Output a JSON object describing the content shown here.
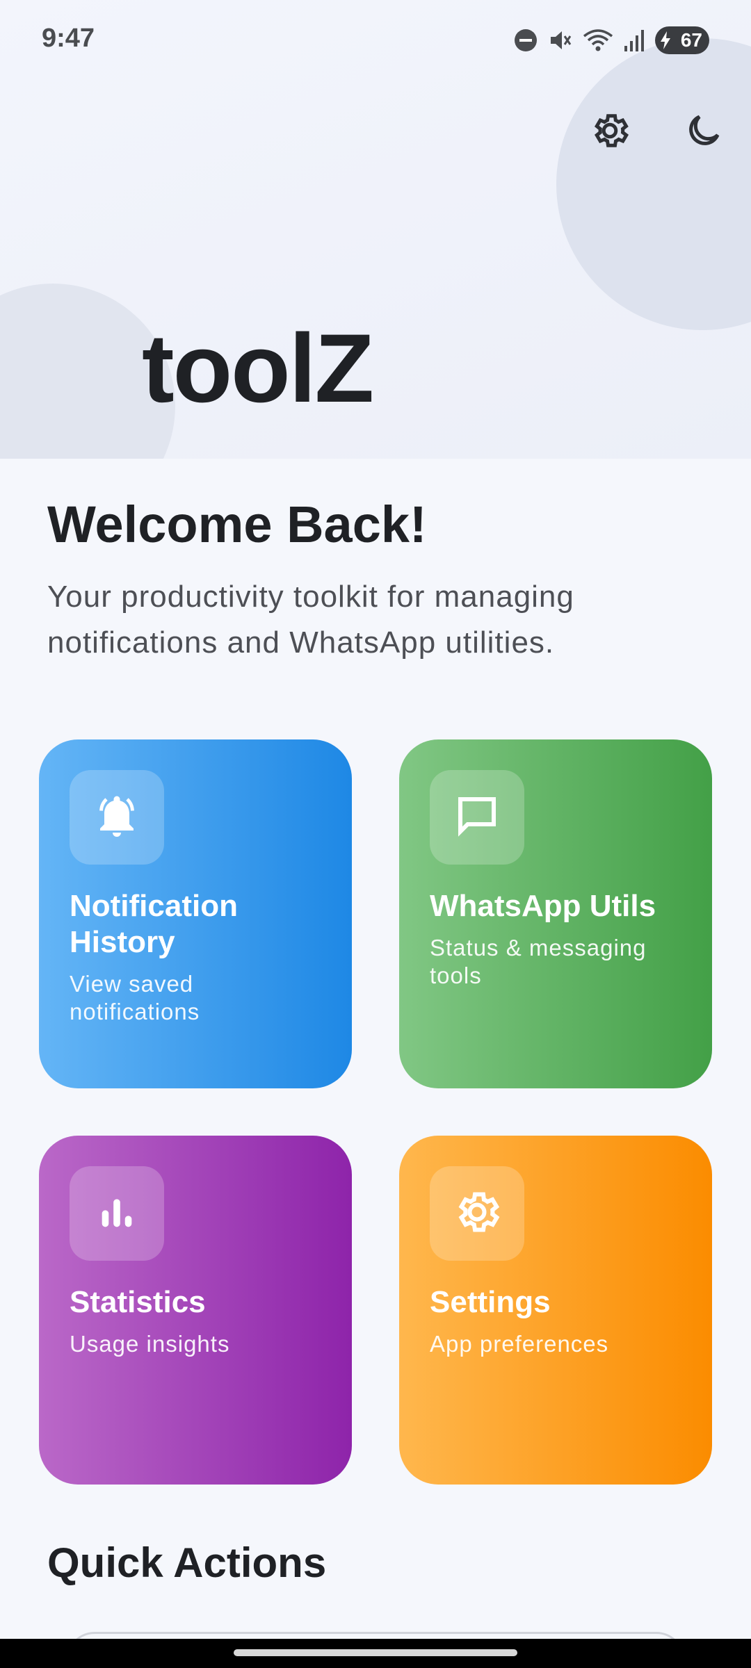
{
  "status_bar": {
    "time": "9:47",
    "battery_level": "67",
    "icons": [
      "do-not-disturb-icon",
      "mute-icon",
      "wifi-icon",
      "signal-icon",
      "battery-charging-icon"
    ]
  },
  "header": {
    "app_title": "toolZ",
    "actions": [
      "settings-gear-icon",
      "dark-mode-moon-icon"
    ]
  },
  "main": {
    "welcome_title": "Welcome Back!",
    "welcome_subtitle": "Your productivity toolkit for managing notifications and WhatsApp utilities.",
    "cards": [
      {
        "title": "Notification History",
        "description": "View saved notifications",
        "icon": "bell-icon",
        "color": "#1e88e5"
      },
      {
        "title": "WhatsApp Utils",
        "description": "Status & messaging tools",
        "icon": "chat-bubble-icon",
        "color": "#43a047"
      },
      {
        "title": "Statistics",
        "description": "Usage insights",
        "icon": "bar-chart-icon",
        "color": "#8e24aa"
      },
      {
        "title": "Settings",
        "description": "App preferences",
        "icon": "gear-icon",
        "color": "#fb8c00"
      }
    ],
    "quick_actions_title": "Quick Actions"
  }
}
